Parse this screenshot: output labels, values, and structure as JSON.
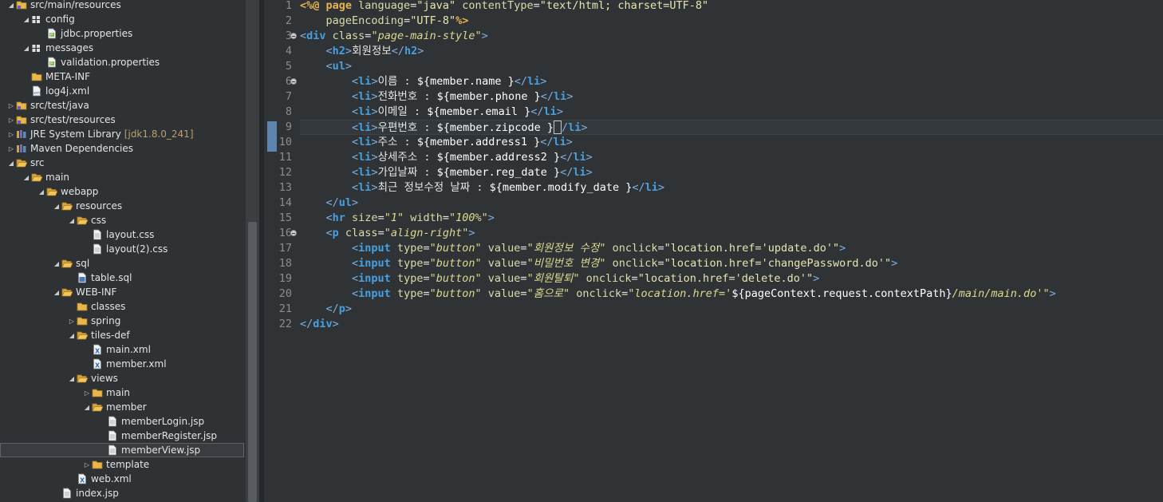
{
  "explorer": {
    "rows": [
      {
        "depth": 1,
        "arrow": "open",
        "icon": "folder-src",
        "label": "src/main/resources"
      },
      {
        "depth": 2,
        "arrow": "open",
        "icon": "package",
        "label": "config"
      },
      {
        "depth": 3,
        "arrow": "none",
        "icon": "file-properties",
        "label": "jdbc.properties"
      },
      {
        "depth": 2,
        "arrow": "open",
        "icon": "package",
        "label": "messages"
      },
      {
        "depth": 3,
        "arrow": "none",
        "icon": "file-properties",
        "label": "validation.properties"
      },
      {
        "depth": 2,
        "arrow": "none",
        "icon": "folder",
        "label": "META-INF"
      },
      {
        "depth": 2,
        "arrow": "none",
        "icon": "file-xml",
        "label": "log4j.xml"
      },
      {
        "depth": 1,
        "arrow": "closed",
        "icon": "folder-src",
        "label": "src/test/java"
      },
      {
        "depth": 1,
        "arrow": "closed",
        "icon": "folder-src",
        "label": "src/test/resources"
      },
      {
        "depth": 1,
        "arrow": "closed",
        "icon": "library",
        "label": "JRE System Library",
        "decoration": "[jdk1.8.0_241]"
      },
      {
        "depth": 1,
        "arrow": "closed",
        "icon": "library",
        "label": "Maven Dependencies"
      },
      {
        "depth": 1,
        "arrow": "open",
        "icon": "folder-open",
        "label": "src"
      },
      {
        "depth": 2,
        "arrow": "open",
        "icon": "folder-open",
        "label": "main"
      },
      {
        "depth": 3,
        "arrow": "open",
        "icon": "folder-open",
        "label": "webapp"
      },
      {
        "depth": 4,
        "arrow": "open",
        "icon": "folder-open",
        "label": "resources"
      },
      {
        "depth": 5,
        "arrow": "open",
        "icon": "folder-open",
        "label": "css"
      },
      {
        "depth": 6,
        "arrow": "none",
        "icon": "file-text",
        "label": "layout.css"
      },
      {
        "depth": 6,
        "arrow": "none",
        "icon": "file-text",
        "label": "layout(2).css"
      },
      {
        "depth": 4,
        "arrow": "open",
        "icon": "folder-open",
        "label": "sql"
      },
      {
        "depth": 5,
        "arrow": "none",
        "icon": "file-sql",
        "label": "table.sql"
      },
      {
        "depth": 4,
        "arrow": "open",
        "icon": "folder-open",
        "label": "WEB-INF"
      },
      {
        "depth": 5,
        "arrow": "none",
        "icon": "folder",
        "label": "classes"
      },
      {
        "depth": 5,
        "arrow": "closed",
        "icon": "folder",
        "label": "spring"
      },
      {
        "depth": 5,
        "arrow": "open",
        "icon": "folder-open",
        "label": "tiles-def"
      },
      {
        "depth": 6,
        "arrow": "none",
        "icon": "file-xml-x",
        "label": "main.xml"
      },
      {
        "depth": 6,
        "arrow": "none",
        "icon": "file-xml-x",
        "label": "member.xml"
      },
      {
        "depth": 5,
        "arrow": "open",
        "icon": "folder-open",
        "label": "views"
      },
      {
        "depth": 6,
        "arrow": "closed",
        "icon": "folder",
        "label": "main"
      },
      {
        "depth": 6,
        "arrow": "open",
        "icon": "folder-open",
        "label": "member"
      },
      {
        "depth": 7,
        "arrow": "none",
        "icon": "file-text",
        "label": "memberLogin.jsp"
      },
      {
        "depth": 7,
        "arrow": "none",
        "icon": "file-text",
        "label": "memberRegister.jsp"
      },
      {
        "depth": 7,
        "arrow": "none",
        "icon": "file-text",
        "label": "memberView.jsp",
        "selected": true
      },
      {
        "depth": 6,
        "arrow": "closed",
        "icon": "folder",
        "label": "template"
      },
      {
        "depth": 5,
        "arrow": "none",
        "icon": "file-xml-x",
        "label": "web.xml"
      },
      {
        "depth": 4,
        "arrow": "none",
        "icon": "file-text",
        "label": "index.jsp"
      }
    ]
  },
  "editor": {
    "current_line": 9,
    "changed_lines": [
      9,
      10
    ],
    "fold_lines": [
      3,
      6,
      16
    ],
    "lines": [
      [
        [
          "jsp",
          "<%@ "
        ],
        [
          "kw",
          "page "
        ],
        [
          "attr",
          "language"
        ],
        [
          "txt",
          "="
        ],
        [
          "str",
          "\"java\""
        ],
        [
          "txt",
          " "
        ],
        [
          "attr",
          "contentType"
        ],
        [
          "txt",
          "="
        ],
        [
          "str",
          "\"text/html; charset=UTF-8\""
        ]
      ],
      [
        [
          "txt",
          "    "
        ],
        [
          "attr",
          "pageEncoding"
        ],
        [
          "txt",
          "="
        ],
        [
          "str",
          "\"UTF-8\""
        ],
        [
          "jsp",
          "%>"
        ]
      ],
      [
        [
          "br",
          "<"
        ],
        [
          "tag",
          "div "
        ],
        [
          "attr",
          "class"
        ],
        [
          "txt",
          "="
        ],
        [
          "istr",
          "\"page-main-style\""
        ],
        [
          "br",
          ">"
        ]
      ],
      [
        [
          "txt",
          "    "
        ],
        [
          "br",
          "<"
        ],
        [
          "tag",
          "h2"
        ],
        [
          "br",
          ">"
        ],
        [
          "txt",
          "회원정보"
        ],
        [
          "br",
          "</"
        ],
        [
          "tag",
          "h2"
        ],
        [
          "br",
          ">"
        ]
      ],
      [
        [
          "txt",
          "    "
        ],
        [
          "br",
          "<"
        ],
        [
          "tag",
          "ul"
        ],
        [
          "br",
          ">"
        ]
      ],
      [
        [
          "txt",
          "        "
        ],
        [
          "br",
          "<"
        ],
        [
          "tag",
          "li"
        ],
        [
          "br",
          ">"
        ],
        [
          "txt",
          "이름 : "
        ],
        [
          "el",
          "${member.name }"
        ],
        [
          "br",
          "</"
        ],
        [
          "tag",
          "li"
        ],
        [
          "br",
          ">"
        ]
      ],
      [
        [
          "txt",
          "        "
        ],
        [
          "br",
          "<"
        ],
        [
          "tag",
          "li"
        ],
        [
          "br",
          ">"
        ],
        [
          "txt",
          "전화번호 : "
        ],
        [
          "el",
          "${member.phone }"
        ],
        [
          "br",
          "</"
        ],
        [
          "tag",
          "li"
        ],
        [
          "br",
          ">"
        ]
      ],
      [
        [
          "txt",
          "        "
        ],
        [
          "br",
          "<"
        ],
        [
          "tag",
          "li"
        ],
        [
          "br",
          ">"
        ],
        [
          "txt",
          "이메일 : "
        ],
        [
          "el",
          "${member.email }"
        ],
        [
          "br",
          "</"
        ],
        [
          "tag",
          "li"
        ],
        [
          "br",
          ">"
        ]
      ],
      [
        [
          "txt",
          "        "
        ],
        [
          "br",
          "<"
        ],
        [
          "tag",
          "li"
        ],
        [
          "br",
          ">"
        ],
        [
          "txt",
          "우편번호 : "
        ],
        [
          "el",
          "${member.zipcode }"
        ],
        [
          "caret",
          ""
        ],
        [
          "br",
          "/"
        ],
        [
          "tag",
          "li"
        ],
        [
          "br",
          ">"
        ]
      ],
      [
        [
          "txt",
          "        "
        ],
        [
          "br",
          "<"
        ],
        [
          "tag",
          "li"
        ],
        [
          "br",
          ">"
        ],
        [
          "txt",
          "주소 : "
        ],
        [
          "el",
          "${member.address1 }"
        ],
        [
          "br",
          "</"
        ],
        [
          "tag",
          "li"
        ],
        [
          "br",
          ">"
        ]
      ],
      [
        [
          "txt",
          "        "
        ],
        [
          "br",
          "<"
        ],
        [
          "tag",
          "li"
        ],
        [
          "br",
          ">"
        ],
        [
          "txt",
          "상세주소 : "
        ],
        [
          "el",
          "${member.address2 }"
        ],
        [
          "br",
          "</"
        ],
        [
          "tag",
          "li"
        ],
        [
          "br",
          ">"
        ]
      ],
      [
        [
          "txt",
          "        "
        ],
        [
          "br",
          "<"
        ],
        [
          "tag",
          "li"
        ],
        [
          "br",
          ">"
        ],
        [
          "txt",
          "가입날짜 : "
        ],
        [
          "el",
          "${member.reg_date }"
        ],
        [
          "br",
          "</"
        ],
        [
          "tag",
          "li"
        ],
        [
          "br",
          ">"
        ]
      ],
      [
        [
          "txt",
          "        "
        ],
        [
          "br",
          "<"
        ],
        [
          "tag",
          "li"
        ],
        [
          "br",
          ">"
        ],
        [
          "txt",
          "최근 정보수정 날짜 : "
        ],
        [
          "el",
          "${member.modify_date }"
        ],
        [
          "br",
          "</"
        ],
        [
          "tag",
          "li"
        ],
        [
          "br",
          ">"
        ]
      ],
      [
        [
          "txt",
          "    "
        ],
        [
          "br",
          "</"
        ],
        [
          "tag",
          "ul"
        ],
        [
          "br",
          ">"
        ]
      ],
      [
        [
          "txt",
          "    "
        ],
        [
          "br",
          "<"
        ],
        [
          "tag",
          "hr "
        ],
        [
          "attr",
          "size"
        ],
        [
          "txt",
          "="
        ],
        [
          "istr",
          "\"1\""
        ],
        [
          "txt",
          " "
        ],
        [
          "attr",
          "width"
        ],
        [
          "txt",
          "="
        ],
        [
          "istr",
          "\"100%\""
        ],
        [
          "br",
          ">"
        ]
      ],
      [
        [
          "txt",
          "    "
        ],
        [
          "br",
          "<"
        ],
        [
          "tag",
          "p "
        ],
        [
          "attr",
          "class"
        ],
        [
          "txt",
          "="
        ],
        [
          "istr",
          "\"align-right\""
        ],
        [
          "br",
          ">"
        ]
      ],
      [
        [
          "txt",
          "        "
        ],
        [
          "br",
          "<"
        ],
        [
          "tag",
          "input "
        ],
        [
          "attr",
          "type"
        ],
        [
          "txt",
          "="
        ],
        [
          "istr",
          "\"button\""
        ],
        [
          "txt",
          " "
        ],
        [
          "attr",
          "value"
        ],
        [
          "txt",
          "="
        ],
        [
          "istr",
          "\"회원정보 수정\""
        ],
        [
          "txt",
          " "
        ],
        [
          "attr",
          "onclick"
        ],
        [
          "txt",
          "="
        ],
        [
          "str",
          "\"location.href='update.do'\""
        ],
        [
          "br",
          ">"
        ]
      ],
      [
        [
          "txt",
          "        "
        ],
        [
          "br",
          "<"
        ],
        [
          "tag",
          "input "
        ],
        [
          "attr",
          "type"
        ],
        [
          "txt",
          "="
        ],
        [
          "istr",
          "\"button\""
        ],
        [
          "txt",
          " "
        ],
        [
          "attr",
          "value"
        ],
        [
          "txt",
          "="
        ],
        [
          "istr",
          "\"비밀번호 변경\""
        ],
        [
          "txt",
          " "
        ],
        [
          "attr",
          "onclick"
        ],
        [
          "txt",
          "="
        ],
        [
          "str",
          "\"location.href='changePassword.do'\""
        ],
        [
          "br",
          ">"
        ]
      ],
      [
        [
          "txt",
          "        "
        ],
        [
          "br",
          "<"
        ],
        [
          "tag",
          "input "
        ],
        [
          "attr",
          "type"
        ],
        [
          "txt",
          "="
        ],
        [
          "istr",
          "\"button\""
        ],
        [
          "txt",
          " "
        ],
        [
          "attr",
          "value"
        ],
        [
          "txt",
          "="
        ],
        [
          "istr",
          "\"회원탈퇴\""
        ],
        [
          "txt",
          " "
        ],
        [
          "attr",
          "onclick"
        ],
        [
          "txt",
          "="
        ],
        [
          "str",
          "\"location.href='delete.do'\""
        ],
        [
          "br",
          ">"
        ]
      ],
      [
        [
          "txt",
          "        "
        ],
        [
          "br",
          "<"
        ],
        [
          "tag",
          "input "
        ],
        [
          "attr",
          "type"
        ],
        [
          "txt",
          "="
        ],
        [
          "istr",
          "\"button\""
        ],
        [
          "txt",
          " "
        ],
        [
          "attr",
          "value"
        ],
        [
          "txt",
          "="
        ],
        [
          "istr",
          "\"홈으로\""
        ],
        [
          "txt",
          " "
        ],
        [
          "attr",
          "onclick"
        ],
        [
          "txt",
          "="
        ],
        [
          "istr",
          "\"location.href='"
        ],
        [
          "el",
          "${pageContext.request.contextPath}"
        ],
        [
          "istr",
          "/main/main.do'\""
        ],
        [
          "br",
          ">"
        ]
      ],
      [
        [
          "txt",
          "    "
        ],
        [
          "br",
          "</"
        ],
        [
          "tag",
          "p"
        ],
        [
          "br",
          ">"
        ]
      ],
      [
        [
          "br",
          "</"
        ],
        [
          "tag",
          "div"
        ],
        [
          "br",
          ">"
        ]
      ]
    ]
  }
}
